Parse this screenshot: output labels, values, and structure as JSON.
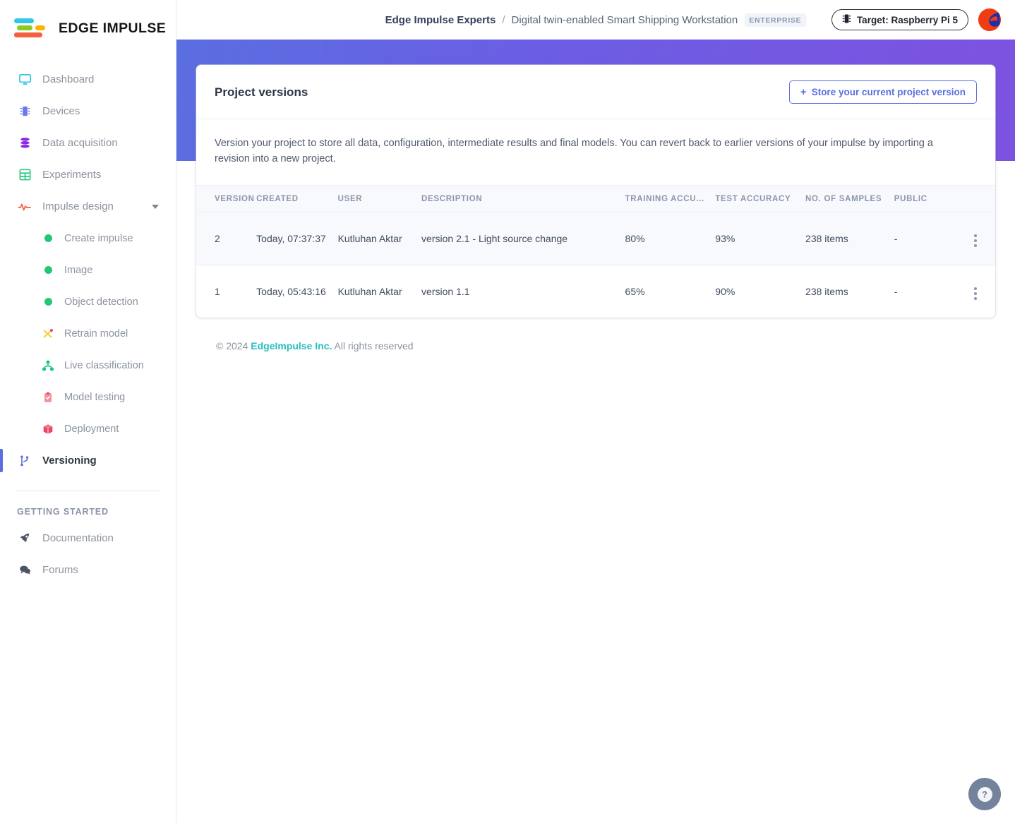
{
  "brand": {
    "name": "EDGE IMPULSE",
    "logo_icon": "edge-impulse-logo"
  },
  "sidebar": {
    "items": [
      {
        "label": "Dashboard",
        "icon": "monitor-icon",
        "color": "#2ec8e6"
      },
      {
        "label": "Devices",
        "icon": "chip-icon",
        "color": "#6c7ae0"
      },
      {
        "label": "Data acquisition",
        "icon": "database-icon",
        "color": "#8a2be2"
      },
      {
        "label": "Experiments",
        "icon": "grid-icon",
        "color": "#22c878"
      },
      {
        "label": "Impulse design",
        "icon": "pulse-icon",
        "color": "#f4603e",
        "expanded": true,
        "caret": "chevron-down-icon"
      }
    ],
    "subitems": [
      {
        "label": "Create impulse",
        "icon": "status-dot-green"
      },
      {
        "label": "Image",
        "icon": "status-dot-green"
      },
      {
        "label": "Object detection",
        "icon": "status-dot-green"
      },
      {
        "label": "Retrain model",
        "icon": "shuffle-icon"
      },
      {
        "label": "Live classification",
        "icon": "nodes-icon"
      },
      {
        "label": "Model testing",
        "icon": "clipboard-check-icon"
      },
      {
        "label": "Deployment",
        "icon": "box-icon"
      }
    ],
    "active_item": {
      "label": "Versioning",
      "icon": "git-branch-icon"
    },
    "getting_started_label": "GETTING STARTED",
    "getting_started": [
      {
        "label": "Documentation",
        "icon": "rocket-icon"
      },
      {
        "label": "Forums",
        "icon": "chat-icon"
      }
    ]
  },
  "topbar": {
    "org": "Edge Impulse Experts",
    "separator": "/",
    "project": "Digital twin-enabled Smart Shipping Workstation",
    "plan_badge": "ENTERPRISE",
    "target_label": "Target: Raspberry Pi 5",
    "target_icon": "chip-icon",
    "avatar_icon": "user-avatar"
  },
  "card": {
    "title": "Project versions",
    "store_button": "Store your current project version",
    "store_button_icon": "plus-icon",
    "description": "Version your project to store all data, configuration, intermediate results and final models. You can revert back to earlier versions of your impulse by importing a revision into a new project."
  },
  "table": {
    "columns": [
      "VERSION",
      "CREATED",
      "USER",
      "DESCRIPTION",
      "TRAINING ACCU…",
      "TEST ACCURACY",
      "NO. OF SAMPLES",
      "PUBLIC"
    ],
    "rows": [
      {
        "version": "2",
        "created": "Today, 07:37:37",
        "user": "Kutluhan Aktar",
        "description": "version 2.1 - Light source change",
        "training_accuracy": "80%",
        "test_accuracy": "93%",
        "samples": "238 items",
        "public": "-",
        "menu_icon": "kebab-menu-icon"
      },
      {
        "version": "1",
        "created": "Today, 05:43:16",
        "user": "Kutluhan Aktar",
        "description": "version 1.1",
        "training_accuracy": "65%",
        "test_accuracy": "90%",
        "samples": "238 items",
        "public": "-",
        "menu_icon": "kebab-menu-icon"
      }
    ]
  },
  "footer": {
    "copyright": "© 2024",
    "company": "EdgeImpulse Inc.",
    "rights": "All rights reserved"
  },
  "help": {
    "icon": "question-mark-icon",
    "symbol": "?"
  },
  "colors": {
    "accent_blue": "#5a6ee0",
    "banner_left": "#5a6ee0",
    "banner_right": "#7d52e0",
    "teal": "#2bbfbd",
    "green_dot": "#22c878"
  }
}
